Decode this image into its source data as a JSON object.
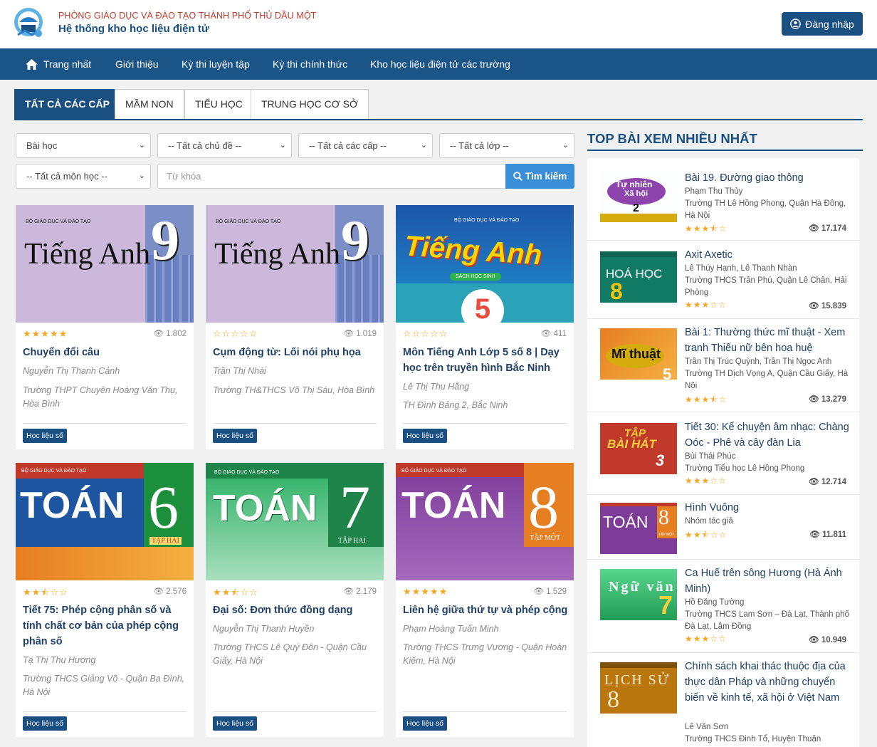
{
  "header": {
    "dept": "PHÒNG GIÁO DỤC VÀ ĐÀO TẠO THÀNH PHỐ THỦ DẦU MỘT",
    "system": "Hệ thống kho học liệu điện tử",
    "login": "Đăng nhập"
  },
  "nav": {
    "items": [
      "Trang nhất",
      "Giới thiệu",
      "Kỳ thi luyện tập",
      "Kỳ thi chính thức",
      "Kho học liệu điện tử các trường"
    ]
  },
  "tabs": [
    "TẤT CẢ CÁC CẤP",
    "MẦM NON",
    "TIỂU HỌC",
    "TRUNG HỌC CƠ SỞ"
  ],
  "filters": {
    "type": "Bài học",
    "topic": "-- Tất cả chủ đề --",
    "level": "-- Tất cả các cấp --",
    "grade": "-- Tất cả lớp --",
    "subject": "-- Tất cả môn học --",
    "keyword_placeholder": "Từ khóa",
    "search": "Tìm kiếm"
  },
  "cards": [
    {
      "title": "Chuyển đổi câu",
      "author": "Nguyễn Thị Thanh Cảnh",
      "school": "Trường THPT Chuyên Hoàng Văn Thụ, Hòa Bình",
      "views": "1.802",
      "rating": 5,
      "badge": "Học liệu số",
      "cover": {
        "pub": "BỘ GIÁO DỤC VÀ ĐÀO TẠO",
        "title": "Tiếng Anh",
        "num": "9"
      }
    },
    {
      "title": "Cụm động từ: Lối nói phụ họa",
      "author": "Trần Thị Nhài",
      "school": "Trường TH&THCS Võ Thị Sáu, Hòa Bình",
      "views": "1.019",
      "rating": 0,
      "badge": "Học liệu số",
      "cover": {
        "pub": "BỘ GIÁO DỤC VÀ ĐÀO TẠO",
        "title": "Tiếng Anh",
        "num": "9"
      }
    },
    {
      "title": "Môn Tiếng Anh Lớp 5 số 8 | Dạy học trên truyền hình Bắc Ninh",
      "author": "Lê Thị Thu Hằng",
      "school": "TH Đình Bảng 2, Bắc Ninh",
      "views": "411",
      "rating": 0,
      "badge": "Học liệu số",
      "cover": {
        "pub": "BỘ GIÁO DỤC VÀ ĐÀO TẠO",
        "title": "Tiếng Anh",
        "sub": "SÁCH HỌC SINH",
        "num": "5"
      }
    },
    {
      "title": "Tiết 75: Phép cộng phân số và tính chất cơ bản của phép cộng phân số",
      "author": "Tạ Thị Thu Hương",
      "school": "Trường THCS Giảng Võ - Quận Ba Đình, Hà Nội",
      "views": "2.576",
      "rating": 2.5,
      "badge": "Học liệu số",
      "cover": {
        "pub": "BỘ GIÁO DỤC VÀ ĐÀO TẠO",
        "title": "TOÁN",
        "num": "6",
        "tap": "TẬP HAI"
      }
    },
    {
      "title": "Đại số: Đơn thức đồng dạng",
      "author": "Nguyễn Thị Thanh Huyền",
      "school": "Trường THCS Lê Quý Đôn - Quận Cầu Giấy, Hà Nội",
      "views": "2.179",
      "rating": 2.5,
      "badge": "Học liệu số",
      "cover": {
        "pub": "BỘ GIÁO DỤC VÀ ĐÀO TẠO",
        "title": "TOÁN",
        "num": "7",
        "tap": "TẬP HAI"
      }
    },
    {
      "title": "Liên hệ giữa thứ tự và phép cộng",
      "author": "Phạm Hoàng Tuấn Minh",
      "school": "Trường THCS Trưng Vương - Quận Hoàn Kiếm, Hà Nội",
      "views": "1.529",
      "rating": 5,
      "badge": "Học liệu số",
      "cover": {
        "pub": "BỘ GIÁO DỤC VÀ ĐÀO TẠO",
        "title": "TOÁN",
        "num": "8",
        "tap": "TẬP MỘT"
      }
    }
  ],
  "sidebar": {
    "title": "TOP BÀI XEM NHIỀU NHẤT",
    "items": [
      {
        "title": "Bài 19. Đường giao thông",
        "author": "Phạm Thu Thủy",
        "school": "Trường TH Lê Hồng Phong, Quận Hà Đông, Hà Nội",
        "views": "17.174",
        "rating": 3.5,
        "cover": {
          "a": "Tự nhiên",
          "b": "Xã hội",
          "num": "2"
        }
      },
      {
        "title": "Axit Axetic",
        "author": "Lê Thúy Hạnh, Lê Thanh Nhàn",
        "school": "Trường THCS Trần Phú, Quận Lê Chân, Hải Phòng",
        "views": "15.839",
        "rating": 3,
        "cover": {
          "a": "HOÁ HỌC",
          "num": "8"
        }
      },
      {
        "title": "Bài 1: Thường thức mĩ thuật - Xem tranh Thiếu nữ bên hoa huệ",
        "author": "Trần Thị Trúc Quỳnh, Trần Thị Ngọc Anh",
        "school": "Trường TH Dịch Vọng A, Quận Cầu Giấy, Hà Nội",
        "views": "13.279",
        "rating": 3.5,
        "cover": {
          "a": "Mĩ thuật",
          "num": "5"
        }
      },
      {
        "title": "Tiết 30: Kể chuyện âm nhạc: Chàng Oóc - Phê và cây đàn Lia",
        "author": "Bùi Thái Phúc",
        "school": "Trường Tiểu học Lê Hồng Phong",
        "views": "12.714",
        "rating": 3,
        "cover": {
          "a": "TẬP",
          "b": "BÀI HÁT",
          "num": "3"
        }
      },
      {
        "title": "Hình Vuông",
        "author": "Nhóm tác giả",
        "school": "",
        "views": "11.811",
        "rating": 2.5,
        "cover": {
          "a": "TOÁN",
          "num": "8",
          "tap": "TẬP MỘT"
        }
      },
      {
        "title": "Ca Huế trên sông Hương (Hà Ánh Minh)",
        "author": "Hồ Đăng Tường",
        "school": "Trường THCS Lam Sơn – Đà Lạt, Thành phố Đà Lạt, Lâm Đồng",
        "views": "10.949",
        "rating": 3,
        "cover": {
          "a": "Ngữ văn",
          "num": "7"
        }
      },
      {
        "title": "Chính sách khai thác thuộc địa của thực dân Pháp và những chuyển biến về kinh tế, xã hội ở Việt Nam",
        "author": "Lê Văn Sơn",
        "school": "Trường THCS Đinh Tổ, Huyện Thuận",
        "views": "",
        "rating": 0,
        "cover": {
          "a": "LỊCH SỬ",
          "num": "8"
        }
      }
    ]
  },
  "colors": {
    "primary": "#1a4f82",
    "nav": "#1b5487",
    "accent": "#3b8ed8",
    "star": "#f5a623",
    "dept": "#c0392b"
  }
}
